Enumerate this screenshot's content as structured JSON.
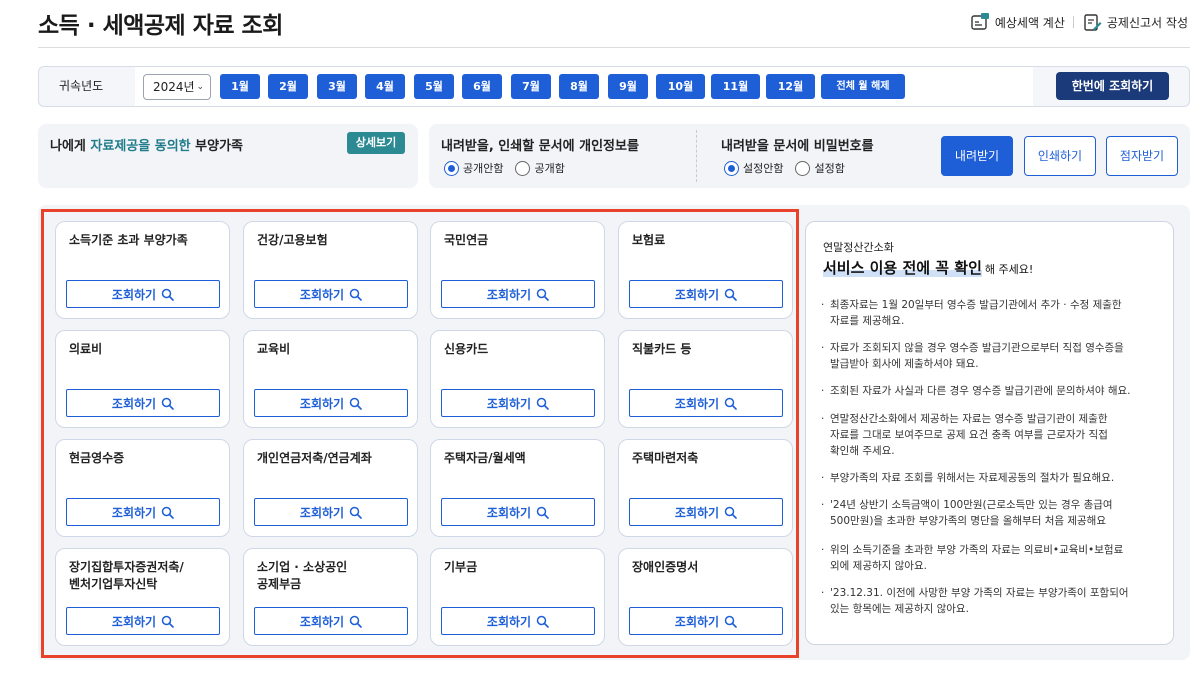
{
  "page": {
    "title": "소득 · 세액공제 자료 조회"
  },
  "top_actions": [
    {
      "label": "예상세액 계산",
      "icon": "calculator-icon"
    },
    {
      "label": "공제신고서 작성",
      "icon": "document-edit-icon"
    }
  ],
  "year_bar": {
    "label": "귀속년도",
    "selected_year": "2024년",
    "months": [
      "1월",
      "2월",
      "3월",
      "4월",
      "5월",
      "6월",
      "7월",
      "8월",
      "9월",
      "10월",
      "11월",
      "12월"
    ],
    "reset_label": "전체 월 해제",
    "query_all_label": "한번에 조회하기"
  },
  "consent": {
    "prefix": "나에게 ",
    "highlight": "자료제공을 동의한",
    "suffix": " 부양가족",
    "detail_label": "상세보기"
  },
  "options": {
    "privacy_title": "내려받을, 인쇄할 문서에 개인정보를",
    "privacy_on": "공개안함",
    "privacy_off": "공개함",
    "password_title": "내려받을 문서에 비밀번호를",
    "password_on": "설정안함",
    "password_off": "설정함",
    "download_label": "내려받기",
    "print_label": "인쇄하기",
    "braille_label": "점자받기"
  },
  "categories": {
    "button_label": "조회하기",
    "items": [
      "소득기준 초과 부양가족",
      "건강/고용보험",
      "국민연금",
      "보험료",
      "의료비",
      "교육비",
      "신용카드",
      "직불카드 등",
      "현금영수증",
      "개인연금저축/연금계좌",
      "주택자금/월세액",
      "주택마련저축",
      "장기집합투자증권저축/\n벤처기업투자신탁",
      "소기업 · 소상공인\n공제부금",
      "기부금",
      "장애인증명서"
    ]
  },
  "notice": {
    "subtitle": "연말정산간소화",
    "heading": "서비스 이용 전에 꼭 확인",
    "heading_tail": "해 주세요!",
    "items": [
      "최종자료는 1월 20일부터 영수증 발급기관에서 추가 · 수정 제출한\n자료를 제공해요.",
      "자료가 조회되지 않을 경우 영수증 발급기관으로부터 직접 영수증을\n발급받아 회사에 제출하셔야 돼요.",
      "조회된 자료가 사실과 다른 경우 영수증 발급기관에 문의하셔야 해요.",
      "연말정산간소화에서 제공하는 자료는 영수증 발급기관이 제출한\n자료를 그대로 보여주므로 공제 요건 충족 여부를 근로자가 직접\n확인해 주세요.",
      "부양가족의 자료 조회를 위해서는 자료제공동의 절차가 필요해요.",
      "'24년 상반기 소득금액이 100만원(근로소득만 있는 경우 총급여\n500만원)을 초과한 부양가족의 명단을 올해부터 처음 제공해요",
      "위의 소득기준을 초과한 부양 가족의 자료는 의료비•교육비•보험료\n외에 제공하지 않아요.",
      "'23.12.31. 이전에 사망한 부양 가족의 자료는 부양가족이 포함되어\n있는 항목에는 제공하지 않아요."
    ]
  },
  "colors": {
    "primary": "#1e5fd8",
    "navy": "#1b3a7a",
    "teal": "#2b8a92",
    "highlight_frame": "#e8432a"
  }
}
